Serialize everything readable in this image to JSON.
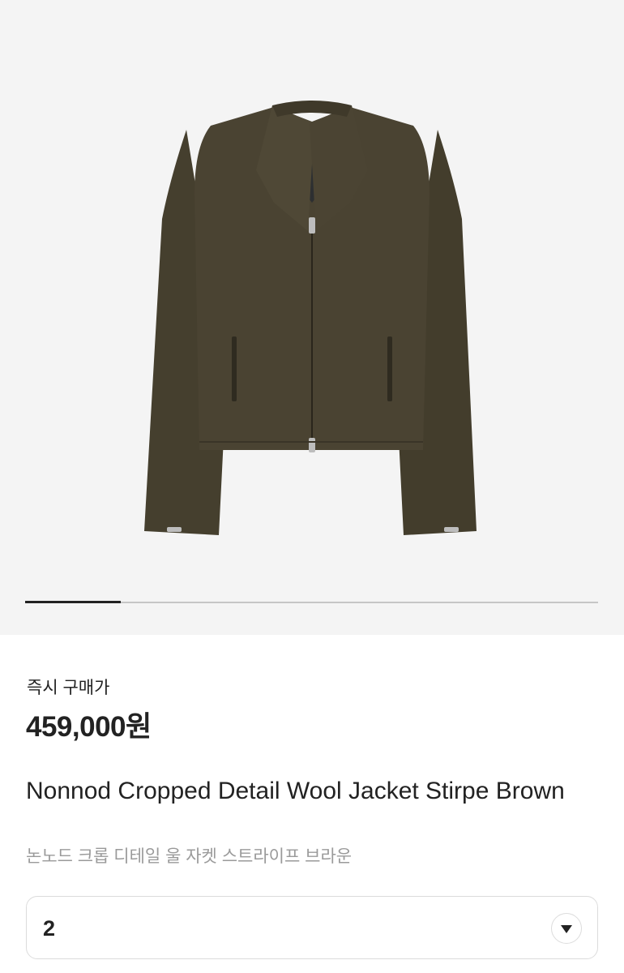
{
  "gallery": {
    "image_icon": "wool-jacket-product-image",
    "progress": 0.167
  },
  "pricing": {
    "label": "즉시 구매가",
    "price": "459,000원"
  },
  "product": {
    "name_en": "Nonnod Cropped Detail Wool Jacket Stirpe Brown",
    "name_ko": "논노드 크롭 디테일 울 자켓 스트라이프 브라운"
  },
  "size_select": {
    "selected": "2",
    "icon": "chevron-down-icon"
  },
  "colors": {
    "gallery_bg": "#f4f4f4",
    "jacket": "#453f2e"
  }
}
